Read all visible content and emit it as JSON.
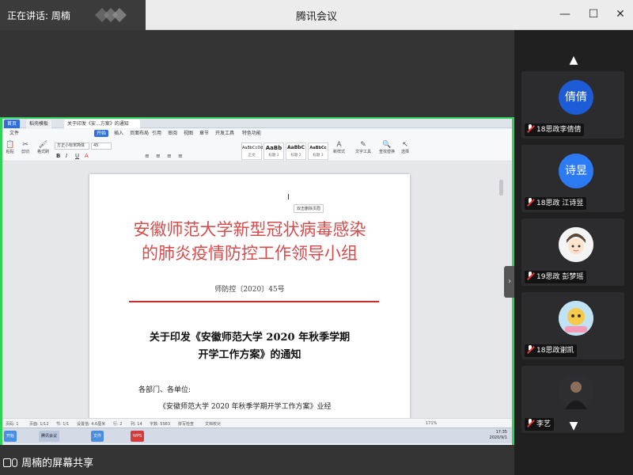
{
  "titlebar": {
    "speaking": "正在讲话: 周楠",
    "app_title": "腾讯会议",
    "minimize": "—",
    "maximize": "☐",
    "close": "✕"
  },
  "share": {
    "label": "周楠的屏幕共享",
    "tabs": [
      "首页",
      "稻壳模板",
      "关于印发《安...方案》的通知"
    ],
    "menus": [
      "文件",
      "开始",
      "插入",
      "页面布局",
      "引用",
      "审阅",
      "视图",
      "章节",
      "开发工具",
      "特色功能"
    ],
    "active_menu": "开始",
    "font_name": "方正小标宋简体",
    "font_size": "45",
    "styles": [
      {
        "sample": "AaBbCcDd",
        "caption": "正文"
      },
      {
        "sample": "AaBb",
        "caption": "标题 1"
      },
      {
        "sample": "AaBbC",
        "caption": "标题 2"
      },
      {
        "sample": "AaBbCc",
        "caption": "标题 3"
      }
    ],
    "ribbon_buttons": [
      "粘贴",
      "剪切",
      "格式刷",
      "新样式",
      "文字工具",
      "查找替换",
      "选择"
    ]
  },
  "document": {
    "org_line1": "安徽师范大学新型冠状病毒感染",
    "org_line2": "的肺炎疫情防控工作领导小组",
    "doc_number": "师防控〔2020〕45号",
    "title_line1": "关于印发《安徽师范大学 2020 年秋季学期",
    "title_line2": "开学工作方案》的通知",
    "salutation": "各部门、各单位:",
    "body_line": "《安徽师范大学 2020 年秋季学期开学工作方案》业经",
    "tooltip": "双击删除页眉"
  },
  "statusbar": {
    "page": "页码: 1",
    "pages": "页面: 1/12",
    "section": "节: 1/1",
    "settings": "设置值: 4.6厘米",
    "row": "行: 2",
    "col": "列: 14",
    "words": "字数: 5983",
    "spell": "拼写检查",
    "doc_check": "文档校对",
    "zoom": "171%"
  },
  "taskbar": {
    "start": "开始",
    "apps": [
      "腾讯会议",
      "文件",
      "WPS"
    ],
    "time": "17:35",
    "date": "2020/9/1"
  },
  "participants": [
    {
      "name": "18思政李倩倩",
      "avatar_text": "倩倩",
      "color": "#1e5bd6"
    },
    {
      "name": "18思政 江诗昱",
      "avatar_text": "诗昱",
      "color": "#2d7bf4"
    },
    {
      "name": "19思政 彭梦瑶",
      "avatar_text": "",
      "color": "#f4f4f4"
    },
    {
      "name": "18思政谢凯",
      "avatar_text": "",
      "color": "#f6d5b8"
    },
    {
      "name": "李艺",
      "avatar_text": "",
      "color": "#3a3a3a"
    }
  ],
  "colors": {
    "share_border": "#30d158",
    "doc_red": "#d64b4b"
  }
}
